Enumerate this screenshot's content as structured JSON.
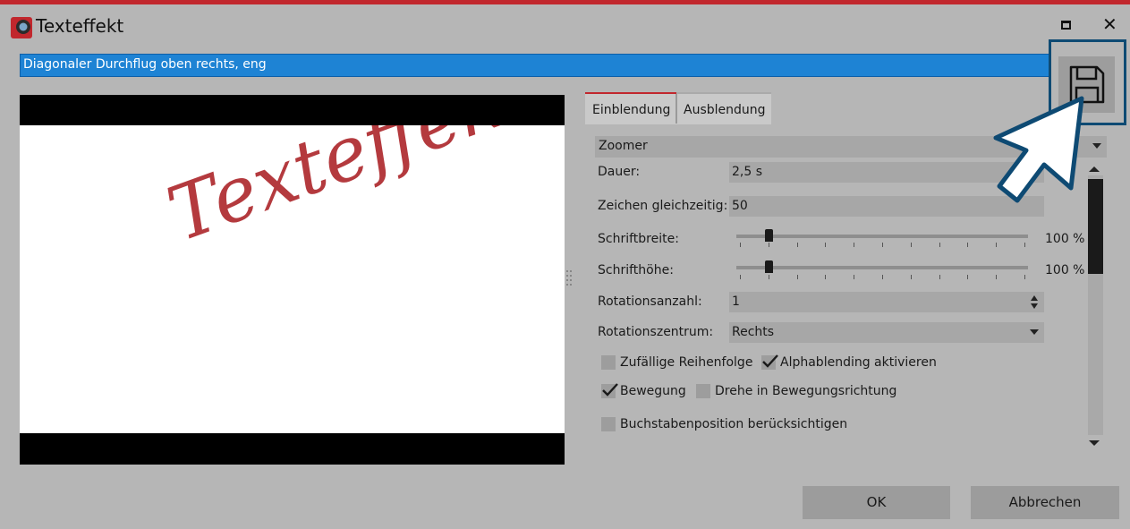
{
  "window": {
    "title": "Texteffekt",
    "accent_color": "#c1272d",
    "selection_color": "#1e83d4"
  },
  "effect_name": "Diagonaler Durchflug oben rechts, eng",
  "preview": {
    "sample_text": "Texteffekt"
  },
  "tabs": [
    {
      "label": "Einblendung",
      "active": true
    },
    {
      "label": "Ausblendung",
      "active": false
    }
  ],
  "effect_type": "Zoomer",
  "settings": {
    "duration": {
      "label": "Dauer:",
      "value": "2,5 s"
    },
    "chars_simultaneous": {
      "label": "Zeichen gleichzeitig:",
      "value": "50"
    },
    "font_width": {
      "label": "Schriftbreite:",
      "value_text": "100 %",
      "value": 0.1
    },
    "font_height": {
      "label": "Schrifthöhe:",
      "value_text": "100 %",
      "value": 0.1
    },
    "rotation_count": {
      "label": "Rotationsanzahl:",
      "value": "1"
    },
    "rotation_center": {
      "label": "Rotationszentrum:",
      "value": "Rechts"
    }
  },
  "checkboxes": [
    {
      "label": "Zufällige Reihenfolge",
      "checked": false
    },
    {
      "label": "Alphablending aktivieren",
      "checked": true
    },
    {
      "label": "Bewegung",
      "checked": true
    },
    {
      "label": "Drehe in Bewegungsrichtung",
      "checked": false
    },
    {
      "label": "Buchstabenposition berücksichtigen",
      "checked": false
    }
  ],
  "buttons": {
    "ok": "OK",
    "cancel": "Abbrechen"
  },
  "icons": {
    "app": "app-logo-icon",
    "maximize": "maximize-icon",
    "close": "close-icon",
    "save": "save-icon",
    "pointer": "hand-pointer-icon"
  }
}
